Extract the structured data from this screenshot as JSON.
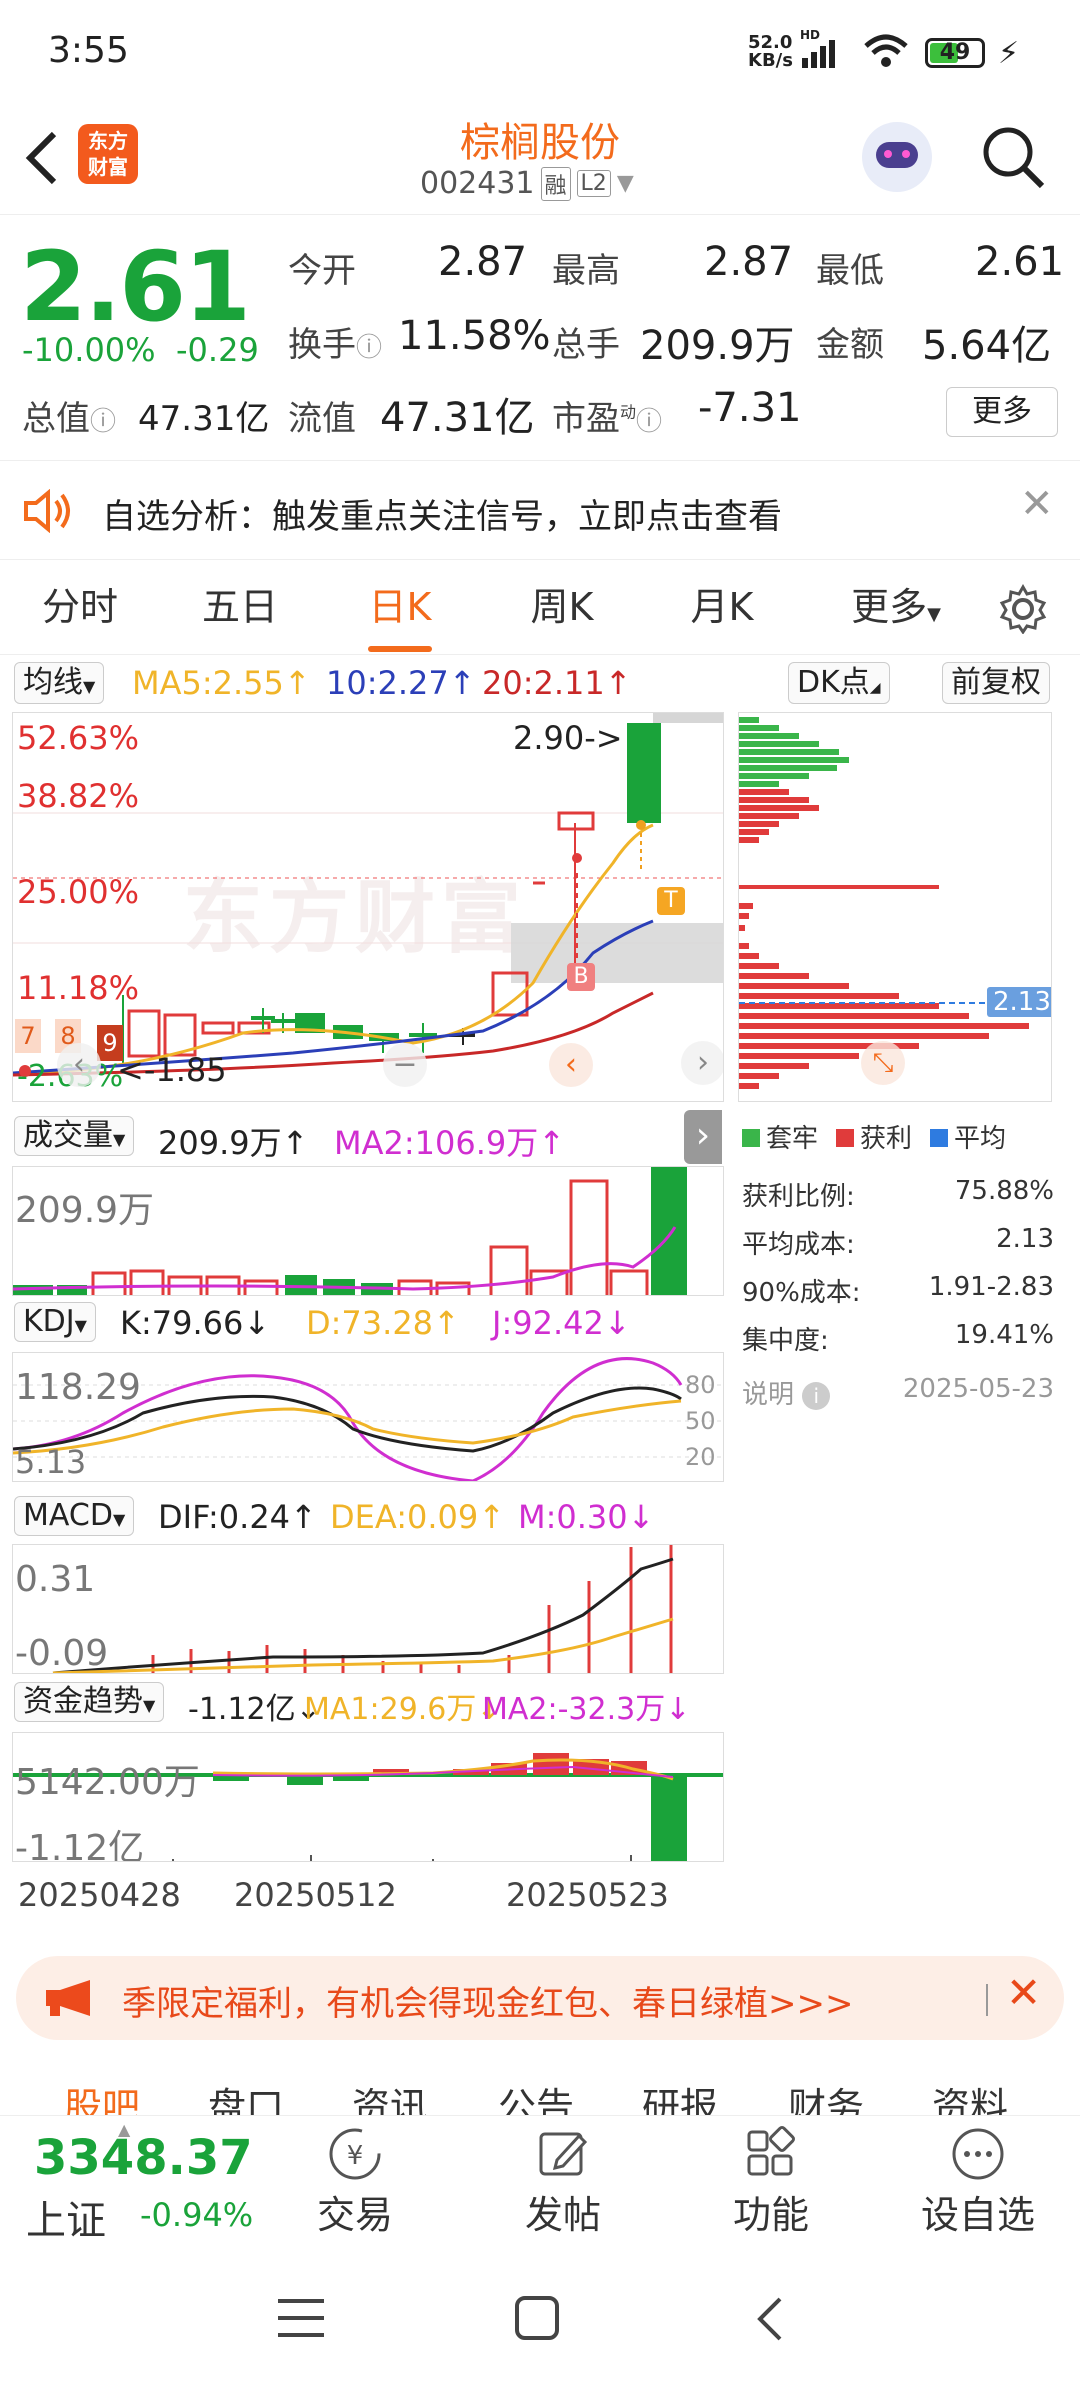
{
  "status": {
    "time": "3:55",
    "net_speed": "52.0",
    "net_unit": "KB/s",
    "net_hd": "HD",
    "battery": "49"
  },
  "header": {
    "logo_line1": "东方",
    "logo_line2": "财富",
    "title": "棕榈股份",
    "code": "002431",
    "rong": "融",
    "l2": "L2"
  },
  "quote": {
    "price": "2.61",
    "pct": "-10.00%",
    "chg": "-0.29",
    "open_label": "今开",
    "open": "2.87",
    "high_label": "最高",
    "high": "2.87",
    "low_label": "最低",
    "low": "2.61",
    "turnover_label": "换手",
    "turnover": "11.58%",
    "vol_label": "总手",
    "vol": "209.9万",
    "amount_label": "金额",
    "amount": "5.64亿",
    "mcap_label": "总值",
    "mcap": "47.31亿",
    "float_label": "流值",
    "float": "47.31亿",
    "pe_label": "市盈",
    "pe_sup": "动",
    "pe": "-7.31",
    "more": "更多"
  },
  "notice": {
    "text": "自选分析：触发重点关注信号，立即点击查看"
  },
  "tabs": [
    {
      "label": "分时"
    },
    {
      "label": "五日"
    },
    {
      "label": "日K"
    },
    {
      "label": "周K"
    },
    {
      "label": "月K"
    },
    {
      "label": "更多"
    }
  ],
  "ma_row": {
    "select": "均线",
    "ma5": "MA5:2.55↑",
    "ma10": "10:2.27↑",
    "ma20": "20:2.11↑",
    "dk": "DK点",
    "fq": "前复权"
  },
  "kchart": {
    "pct1": "52.63%",
    "pct2": "38.82%",
    "pct3": "25.00%",
    "pct4": "11.18%",
    "pct5": "-2.63%",
    "high_mark": "2.90->",
    "low_mark": "<-1.85",
    "nine1": "7",
    "nine2": "8",
    "nine3": "9",
    "b_mark": "B",
    "t_mark": "T",
    "watermark": "东方财富"
  },
  "chip": {
    "price_tag": "2.13",
    "legend": [
      {
        "label": "套牢",
        "color": "#3ab54a"
      },
      {
        "label": "获利",
        "color": "#e03b3b"
      },
      {
        "label": "平均",
        "color": "#2e7be0"
      }
    ],
    "rows": [
      {
        "k": "获利比例:",
        "v": "75.88%"
      },
      {
        "k": "平均成本:",
        "v": "2.13"
      },
      {
        "k": "90%成本:",
        "v": "1.91-2.83"
      },
      {
        "k": "集中度:",
        "v": "19.41%"
      }
    ],
    "note": "说明",
    "date": "2025-05-23"
  },
  "vol_row": {
    "select": "成交量",
    "val": "209.9万↑",
    "ma2": "MA2:106.9万↑",
    "axis": "209.9万"
  },
  "kdj_row": {
    "select": "KDJ",
    "k": "K:79.66↓",
    "d": "D:73.28↑",
    "j": "J:92.42↓",
    "axis_top": "118.29",
    "axis_bot": "5.13",
    "l80": "80",
    "l50": "50",
    "l20": "20"
  },
  "macd_row": {
    "select": "MACD",
    "dif": "DIF:0.24↑",
    "dea": "DEA:0.09↑",
    "m": "M:0.30↓",
    "axis_top": "0.31",
    "axis_bot": "-0.09"
  },
  "fund_row": {
    "select": "资金趋势",
    "val": "-1.12亿↓",
    "ma1": "MA1:29.6万↓",
    "ma2": "MA2:-32.3万↓",
    "axis_top": "5142.00万",
    "axis_bot": "-1.12亿"
  },
  "dates": {
    "d1": "20250428",
    "d2": "20250512",
    "d3": "20250523"
  },
  "promo": {
    "text": "季限定福利，有机会得现金红包、春日绿植>>>"
  },
  "subtabs": [
    {
      "label": "股吧"
    },
    {
      "label": "盘口"
    },
    {
      "label": "资讯"
    },
    {
      "label": "公告"
    },
    {
      "label": "研报"
    },
    {
      "label": "财务"
    },
    {
      "label": "资料"
    }
  ],
  "bottom": {
    "index_val": "3348.37",
    "index_name": "上证",
    "index_pct": "-0.94%",
    "trade": "交易",
    "post": "发帖",
    "func": "功能",
    "watch": "设自选"
  }
}
